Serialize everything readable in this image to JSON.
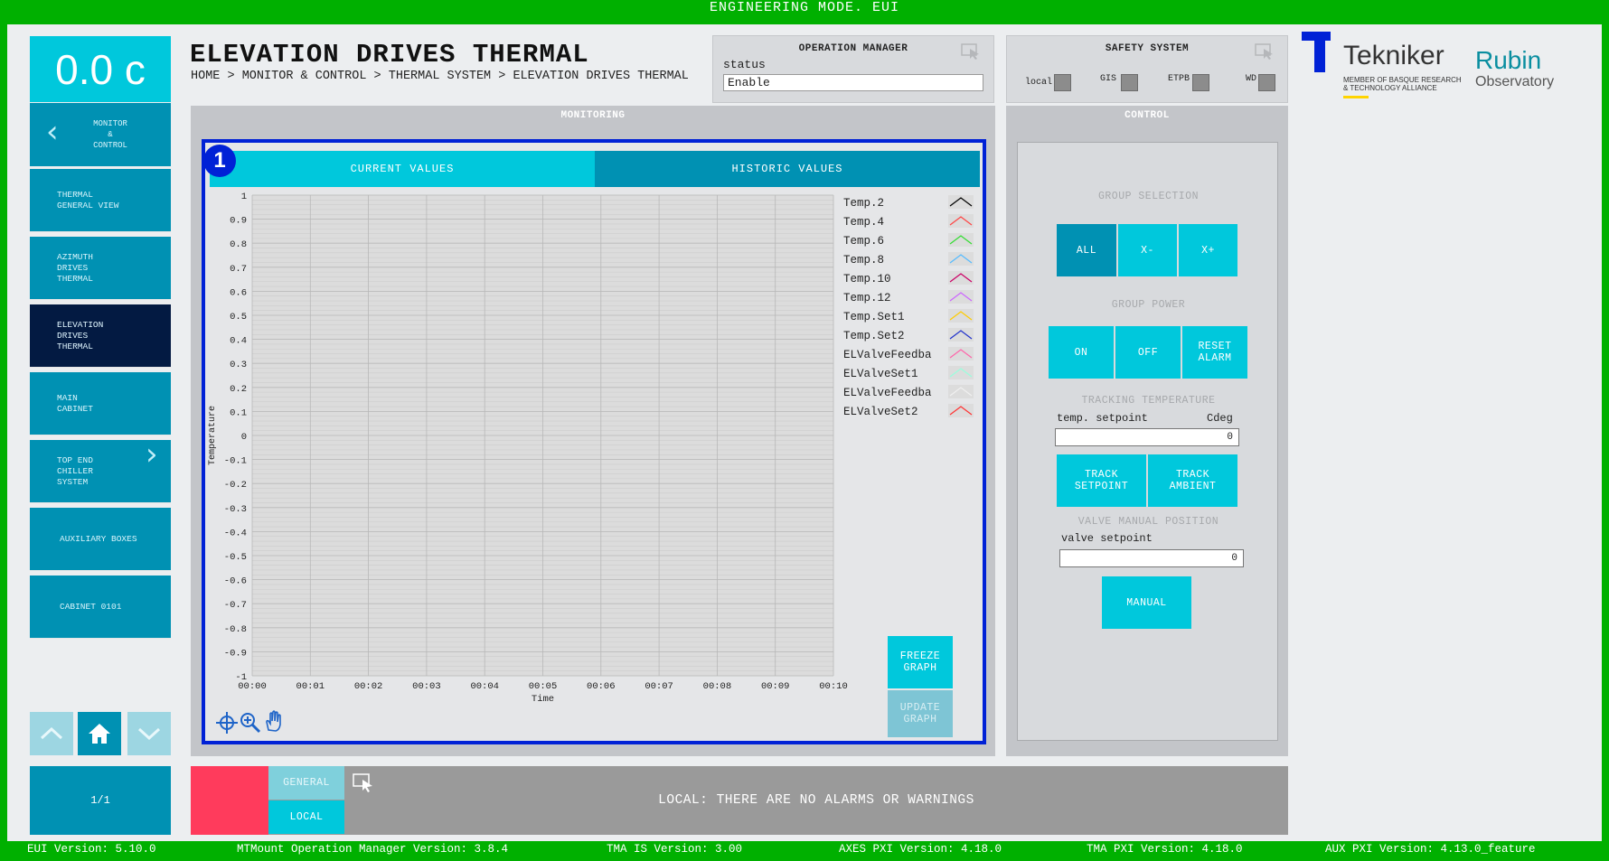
{
  "header": {
    "mode": "ENGINEERING MODE. EUI"
  },
  "temperature_display": "0.0 c",
  "page": {
    "title": "ELEVATION DRIVES THERMAL",
    "breadcrumb": "HOME > MONITOR & CONTROL > THERMAL SYSTEM > ELEVATION DRIVES THERMAL"
  },
  "sidebar": {
    "back_label": "MONITOR\n&\nCONTROL",
    "items": [
      {
        "label": "THERMAL\nGENERAL VIEW"
      },
      {
        "label": "AZIMUTH\nDRIVES\nTHERMAL"
      },
      {
        "label": "ELEVATION\nDRIVES\nTHERMAL"
      },
      {
        "label": "MAIN\nCABINET"
      },
      {
        "label": "TOP END\nCHILLER\nSYSTEM"
      },
      {
        "label": "AUXILIARY BOXES"
      },
      {
        "label": "CABINET 0101"
      }
    ],
    "page_indicator": "1/1"
  },
  "operation_manager": {
    "title": "OPERATION MANAGER",
    "status_label": "status",
    "status_value": "Enable"
  },
  "safety_system": {
    "title": "SAFETY SYSTEM",
    "indicators": [
      "local",
      "GIS",
      "ETPB",
      "WD"
    ]
  },
  "monitoring": {
    "title": "MONITORING",
    "badge": "1",
    "tabs": [
      "CURRENT VALUES",
      "HISTORIC VALUES"
    ],
    "freeze_label": "FREEZE\nGRAPH",
    "update_label": "UPDATE\nGRAPH"
  },
  "chart_data": {
    "type": "line",
    "xlabel": "Time",
    "ylabel": "Temperature",
    "x_ticks": [
      "00:00",
      "00:01",
      "00:02",
      "00:03",
      "00:04",
      "00:05",
      "00:06",
      "00:07",
      "00:08",
      "00:09",
      "00:10"
    ],
    "y_ticks": [
      "1",
      "0.9",
      "0.8",
      "0.7",
      "0.6",
      "0.5",
      "0.4",
      "0.3",
      "0.2",
      "0.1",
      "0",
      "-0.1",
      "-0.2",
      "-0.3",
      "-0.4",
      "-0.5",
      "-0.6",
      "-0.7",
      "-0.8",
      "-0.9",
      "-1"
    ],
    "ylim": [
      -1,
      1
    ],
    "grid": true,
    "series": [
      {
        "name": "Temp.2",
        "color": "#000000",
        "values": []
      },
      {
        "name": "Temp.4",
        "color": "#ff4444",
        "values": []
      },
      {
        "name": "Temp.6",
        "color": "#33dd33",
        "values": []
      },
      {
        "name": "Temp.8",
        "color": "#55bbff",
        "values": []
      },
      {
        "name": "Temp.10",
        "color": "#cc0066",
        "values": []
      },
      {
        "name": "Temp.12",
        "color": "#cc66ff",
        "values": []
      },
      {
        "name": "Temp.Set1",
        "color": "#ffcc00",
        "values": []
      },
      {
        "name": "Temp.Set2",
        "color": "#2233cc",
        "values": []
      },
      {
        "name": "ELValveFeedba",
        "color": "#ff66aa",
        "values": []
      },
      {
        "name": "ELValveSet1",
        "color": "#99ffdd",
        "values": []
      },
      {
        "name": "ELValveFeedba",
        "color": "#f0f0f0",
        "values": []
      },
      {
        "name": "ELValveSet2",
        "color": "#ff3333",
        "values": []
      }
    ]
  },
  "control": {
    "title": "CONTROL",
    "group_selection": {
      "label": "GROUP SELECTION",
      "buttons": [
        "ALL",
        "X-",
        "X+"
      ]
    },
    "group_power": {
      "label": "GROUP POWER",
      "buttons": [
        "ON",
        "OFF",
        "RESET\nALARM"
      ]
    },
    "tracking": {
      "label": "TRACKING TEMPERATURE",
      "field_label": "temp. setpoint",
      "unit": "Cdeg",
      "value": "0",
      "buttons": [
        "TRACK\nSETPOINT",
        "TRACK\nAMBIENT"
      ]
    },
    "valve": {
      "label": "VALVE MANUAL POSITION",
      "field_label": "valve setpoint",
      "value": "0",
      "button": "MANUAL"
    }
  },
  "alarms": {
    "tab_general": "GENERAL",
    "tab_local": "LOCAL",
    "message": "LOCAL: THERE ARE NO ALARMS OR WARNINGS"
  },
  "logos": {
    "tekniker": "Tekniker",
    "tekniker_sub": "MEMBER OF BASQUE RESEARCH\n& TECHNOLOGY ALLIANCE",
    "rubin": "Rubin",
    "observatory": "Observatory"
  },
  "footer": [
    "EUI Version: 5.10.0",
    "MTMount Operation Manager Version: 3.8.4",
    "TMA IS Version: 3.00",
    "AXES PXI Version: 4.18.0",
    "TMA PXI Version: 4.18.0",
    "AUX PXI Version: 4.13.0_feature"
  ],
  "colors": {
    "frame": "#00b000",
    "accent": "#00c8dc",
    "accent_dark": "#0091b3",
    "selected": "#031a42",
    "highlight": "#0021d6",
    "alarm": "#ff3b5c"
  }
}
